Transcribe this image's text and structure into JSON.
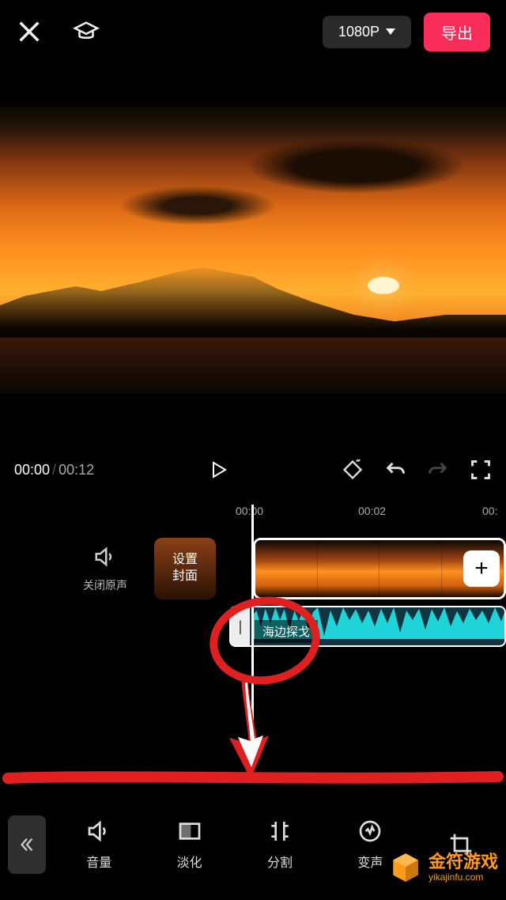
{
  "header": {
    "resolution_label": "1080P",
    "export_label": "导出"
  },
  "playback": {
    "current_time": "00:00",
    "total_time": "00:12"
  },
  "timeline": {
    "ticks": [
      "00:00",
      "00:02",
      "00:"
    ],
    "mute_label": "关闭原声",
    "cover_label_line1": "设置",
    "cover_label_line2": "封面",
    "audio_clip_name": "海边探戈",
    "add_symbol": "+"
  },
  "tools": {
    "back": "«",
    "items": [
      {
        "id": "volume",
        "label": "音量"
      },
      {
        "id": "fade",
        "label": "淡化"
      },
      {
        "id": "split",
        "label": "分割"
      },
      {
        "id": "voicechange",
        "label": "变声"
      }
    ]
  },
  "watermark": {
    "title": "金符游戏",
    "url": "yikajinfu.com"
  }
}
